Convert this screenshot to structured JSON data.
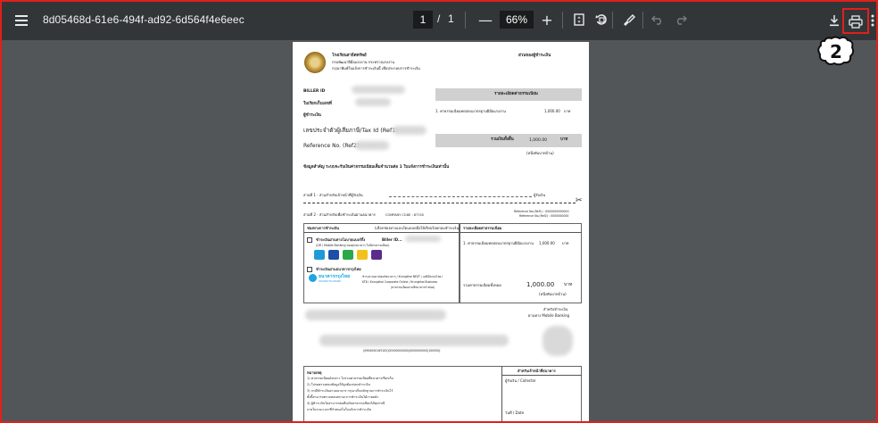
{
  "toolbar": {
    "doc_title": "8d05468d-61e6-494f-ad92-6d564f4e6eec",
    "page_current": "1",
    "page_sep": "/",
    "page_total": "1",
    "zoom_out": "—",
    "zoom_level": "66%",
    "zoom_in": "+"
  },
  "step_badge": "2",
  "document": {
    "org_line1": "โรงเรียนสาธิตทรัพย์",
    "org_line2": "กรมพัฒนาฝีมือแรงงาน กระทรวงแรงงาน",
    "org_line3": "กรุณาพิมพ์ใบแจ้งการชำระเงินนี้ เพื่อประกอบการชำระเงิน",
    "copy_label": "ส่วนของผู้ชำระเงิน",
    "biller_id_label": "BILLER ID",
    "invoice_label": "ใบเรียกเก็บเลขที่",
    "payer_label": "ผู้ชำระเงิน",
    "items_header": "รายละเอียดค่าธรรมเนียม",
    "item1": "1. ค่าธรรมเนียมทดสอบมาตรฐานฝีมือแรงงาน",
    "item1_amount": "1,000.00",
    "currency": "บาท",
    "taxid_label": "เลขประจำตัวผู้เสียภาษี/Tax Id (Ref1)",
    "ref2_label": "Reference No. (Ref2) :",
    "total_label": "รวมเงินทั้งสิ้น",
    "total_amount": "1,000.00",
    "total_words": "(หนึ่งพันบาทถ้วน)",
    "note": "ข้อมูลสำคัญ ระบบจะรับเงินค่าธรรมเนียมเต็มจำนวนต่อ 1 ใบแจ้งการชำระเงินเท่านั้น",
    "cut_line_label": "ส่วนที่ 1 - ส่วนสำหรับเจ้าหน้าที่ผู้รับเงิน",
    "payer_line_label": "ผู้รับเงิน",
    "part2_label": "ส่วนที่ 2 - ส่วนสำหรับเพื่อชำระเงินผ่านธนาคาร",
    "company_code": "COMPANY CODE : 87745",
    "bank_ref1": "Reference No.(Ref1) : 0000000000000",
    "bank_ref2": "Reference No.(Ref2) : 0000000000",
    "channels_header": "ช่องทางการชำระเงิน",
    "channels_note": "(เลือกช่องทางแบบใดแบบหนึ่งให้เรียบร้อยก่อนชำระเงิน)",
    "items_header2": "รายละเอียดค่าธรรมเนียม",
    "channel1": "ชำระเงินผ่านทางโมบายแบงก์กิ้ง",
    "channel1_biller": "Biller ID...",
    "channel1_sub": "(QR / Mobile Banking ของทุกธนาคาร ไม่มีค่าธรรมเนียม)",
    "channel2": "ชำระเงินผ่านธนาคารกรุงไทย",
    "ktb_name": "ธนาคารกรุงไทย",
    "ktb_name_en": "KRUNGTHAI BANK",
    "ktb_detail1": "ชำระผ่านเคาน์เตอร์ธนาคาร / Krungthai NEXT / เอทีเอ็มกรุงไทย /",
    "ktb_detail2": "KTB / Krungthai Corporate Online / Krungthai Business",
    "ktb_detail3": "(ค่าธรรมเนียมตามที่ธนาคารกำหนด)",
    "item1b": "1. ค่าธรรมเนียมทดสอบมาตรฐานฝีมือแรงงาน",
    "item1b_amount": "1,000.00",
    "total2_label": "รวมค่าธรรมเนียมทั้งหมด",
    "total2_amount": "1,000.00",
    "total2_unit": "บาท",
    "total2_words": "(หนึ่งพันบาทถ้วน)",
    "mobile_label1": "สำหรับชำระเงิน",
    "mobile_label2": "ผ่านทาง Mobile Banking",
    "barcode_digits": "|0994000165161|00000000000|0000000000|100000|",
    "remarks_header": "หมายเหตุ",
    "remark1": "1) ค่าธรรมเนียมดังกล่าว ไม่รวมค่าธรรมเนียมที่ธนาคารเรียกเก็บ",
    "remark2": "2) โปรดตรวจสอบข้อมูลให้ถูกต้องก่อนชำระเงิน",
    "remark3": "3) กรณีชำระเงินผ่านธนาคาร กรุณาเก็บหลักฐานการชำระเงินไว้",
    "remark4": "ทั้งนี้สามารถตรวจสอบสถานะการชำระเงินได้ภายหลัง",
    "remark5": "4) ผู้ชำระเงินไม่สามารถขอคืนเงินค่าธรรมเนียมได้ทุกกรณี",
    "remark6": "ภายในระยะเวลาที่กำหนดในใบแจ้งการชำระเงิน",
    "officer_header": "สำหรับเจ้าหน้าที่ธนาคาร",
    "collector_label": "ผู้รับเงิน / Collector",
    "date_label": "วันที่ / Date"
  }
}
